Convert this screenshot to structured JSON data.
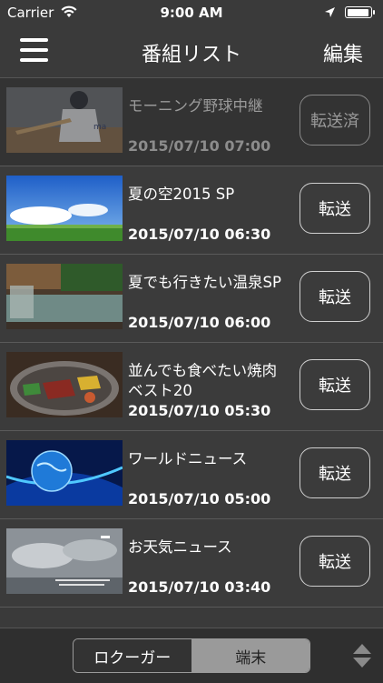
{
  "status": {
    "carrier": "Carrier",
    "time": "9:00 AM",
    "battery_level": 0.95
  },
  "nav": {
    "title": "番組リスト",
    "edit_label": "編集"
  },
  "programs": [
    {
      "title": "モーニング野球中継",
      "date": "2015/07/10 07:00",
      "button": "転送済",
      "transferred": true
    },
    {
      "title": "夏の空2015 SP",
      "date": "2015/07/10 06:30",
      "button": "転送",
      "transferred": false
    },
    {
      "title": "夏でも行きたい温泉SP",
      "date": "2015/07/10 06:00",
      "button": "転送",
      "transferred": false
    },
    {
      "title": "並んでも食べたい焼肉ベスト20",
      "date": "2015/07/10 05:30",
      "button": "転送",
      "transferred": false
    },
    {
      "title": "ワールドニュース",
      "date": "2015/07/10 05:00",
      "button": "転送",
      "transferred": false
    },
    {
      "title": "お天気ニュース",
      "date": "2015/07/10 03:40",
      "button": "転送",
      "transferred": false
    }
  ],
  "tabs": {
    "left": "ロクーガー",
    "right": "端末",
    "selected": "端末"
  },
  "colors": {
    "background": "#3a3a3a",
    "tab_selected": "#9a9a9a"
  }
}
